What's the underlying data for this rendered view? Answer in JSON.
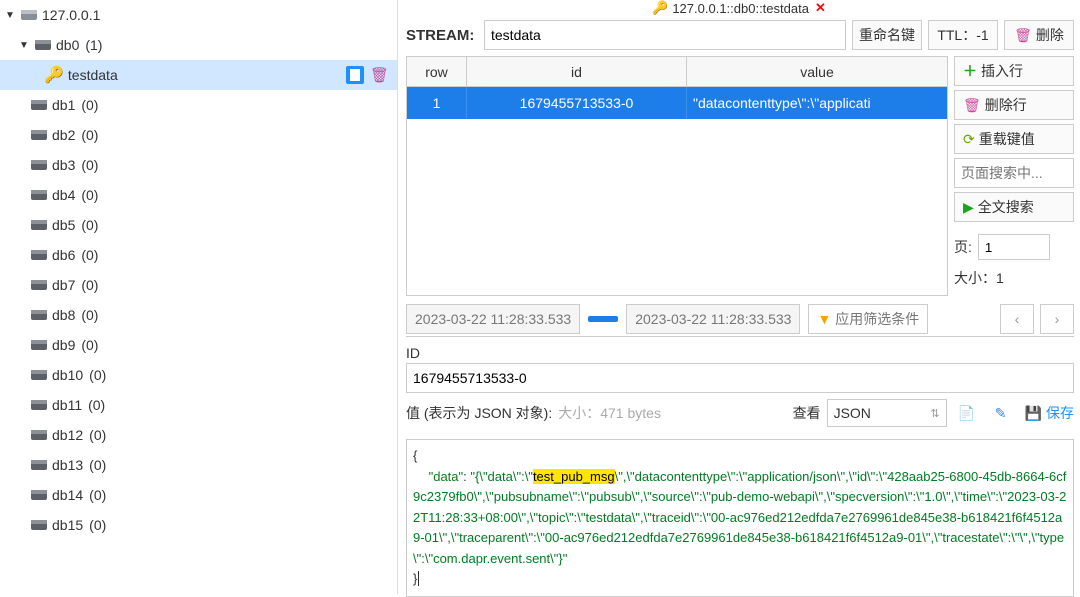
{
  "sidebar": {
    "root_label": "127.0.0.1",
    "db0_label": "db0",
    "db0_count": "(1)",
    "selected_key": "testdata",
    "dbs": [
      {
        "label": "db1",
        "count": "(0)"
      },
      {
        "label": "db2",
        "count": "(0)"
      },
      {
        "label": "db3",
        "count": "(0)"
      },
      {
        "label": "db4",
        "count": "(0)"
      },
      {
        "label": "db5",
        "count": "(0)"
      },
      {
        "label": "db6",
        "count": "(0)"
      },
      {
        "label": "db7",
        "count": "(0)"
      },
      {
        "label": "db8",
        "count": "(0)"
      },
      {
        "label": "db9",
        "count": "(0)"
      },
      {
        "label": "db10",
        "count": "(0)"
      },
      {
        "label": "db11",
        "count": "(0)"
      },
      {
        "label": "db12",
        "count": "(0)"
      },
      {
        "label": "db13",
        "count": "(0)"
      },
      {
        "label": "db14",
        "count": "(0)"
      },
      {
        "label": "db15",
        "count": "(0)"
      }
    ]
  },
  "tab": {
    "title": "127.0.0.1::db0::testdata"
  },
  "header": {
    "stream_label": "STREAM:",
    "key_name": "testdata",
    "rename_label": "重命名键",
    "ttl_label": "TTL：-1",
    "delete_label": "删除"
  },
  "table": {
    "col_row": "row",
    "col_id": "id",
    "col_value": "value",
    "rows": [
      {
        "row": "1",
        "id": "1679455713533-0",
        "value": "\"datacontenttype\\\":\\\"applicati"
      }
    ]
  },
  "sidebuttons": {
    "insert_label": "插入行",
    "delrow_label": "删除行",
    "reload_label": "重载键值",
    "search_ph": "页面搜索中...",
    "fulltext_label": "全文搜索"
  },
  "paging": {
    "page_label": "页:",
    "page_value": "1",
    "size_label": "大小：1"
  },
  "filter": {
    "ts_from": "2023-03-22 11:28:33.533",
    "ts_to": "2023-03-22 11:28:33.533",
    "apply_label": "应用筛选条件"
  },
  "detail": {
    "id_label": "ID",
    "id_value": "1679455713533-0",
    "value_label": "值 (表示为 JSON 对象):",
    "size_label": "大小：471 bytes",
    "view_label": "查看",
    "view_option": "JSON",
    "save_label": "保存"
  },
  "json": {
    "open": "{",
    "key": "\"data\"",
    "colon": ": ",
    "pre_hl": "\"{\\\"data\\\":\\\"",
    "hl": "test_pub_msg",
    "post_hl": "\\\",\\\"datacontenttype\\\":\\\"application/json\\\",\\\"id\\\":\\\"428aab25-6800-45db-8664-6cf9c2379fb0\\\",\\\"pubsubname\\\":\\\"pubsub\\\",\\\"source\\\":\\\"pub-demo-webapi\\\",\\\"specversion\\\":\\\"1.0\\\",\\\"time\\\":\\\"2023-03-22T11:28:33+08:00\\\",\\\"topic\\\":\\\"testdata\\\",\\\"traceid\\\":\\\"00-ac976ed212edfda7e2769961de845e38-b618421f6f4512a9-01\\\",\\\"traceparent\\\":\\\"00-ac976ed212edfda7e2769961de845e38-b618421f6f4512a9-01\\\",\\\"tracestate\\\":\\\"\\\",\\\"type\\\":\\\"com.dapr.event.sent\\\"}\"",
    "close": "}"
  }
}
